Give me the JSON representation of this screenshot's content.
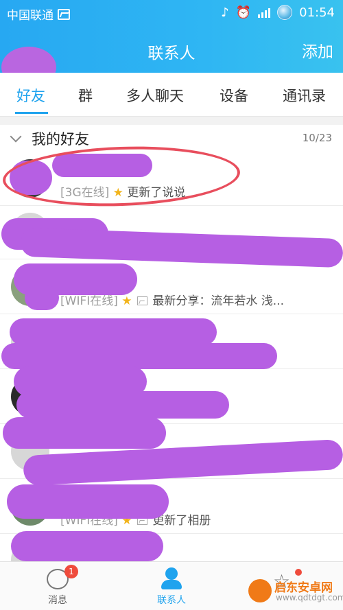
{
  "status_bar": {
    "carrier": "中国联通",
    "time": "01:54"
  },
  "header": {
    "title": "联系人",
    "add_label": "添加"
  },
  "tabs": [
    {
      "label": "好友"
    },
    {
      "label": "群"
    },
    {
      "label": "多人聊天"
    },
    {
      "label": "设备"
    },
    {
      "label": "通讯录"
    }
  ],
  "group": {
    "name": "我的好友",
    "count": "10/23"
  },
  "contacts": [
    {
      "net": "[3G在线]",
      "activity": "更新了说说"
    },
    {
      "net": "",
      "activity": ""
    },
    {
      "net": "[WIFI在线]",
      "activity": "最新分享：流年若水 浅..."
    },
    {
      "net": "",
      "activity": ""
    },
    {
      "net": "",
      "activity": ""
    },
    {
      "net": "",
      "activity": ""
    },
    {
      "net": "[WIFI在线]",
      "activity": "更新了相册"
    }
  ],
  "bottom_nav": [
    {
      "label": "消息",
      "badge": "1"
    },
    {
      "label": "联系人"
    },
    {
      "label": ""
    }
  ],
  "watermark": {
    "name": "启东安卓网",
    "url": "www.qdtdgt.com"
  },
  "colors": {
    "accent": "#1fa3ee",
    "header": "#2fb6f3",
    "redact": "#b65fe3",
    "circle": "#e84e5d"
  }
}
